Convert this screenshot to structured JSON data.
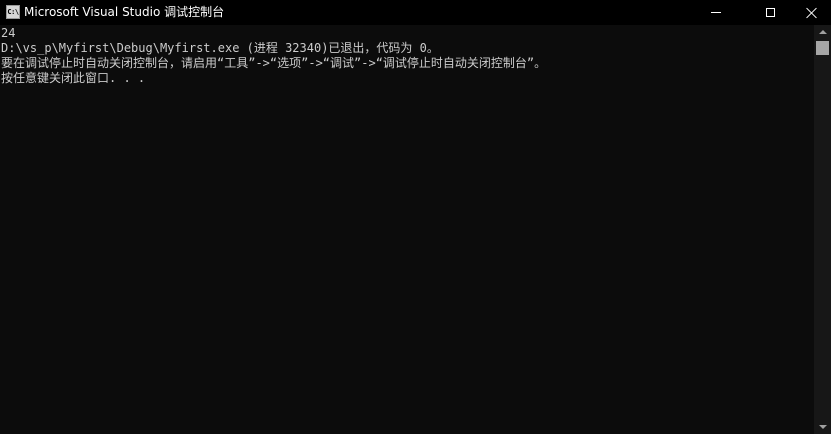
{
  "window": {
    "title": "Microsoft Visual Studio 调试控制台",
    "icon": "console-app-icon",
    "icon_text": "C:\\"
  },
  "console": {
    "lines": [
      "24",
      "D:\\vs_p\\Myfirst\\Debug\\Myfirst.exe (进程 32340)已退出，代码为 0。",
      "要在调试停止时自动关闭控制台，请启用“工具”->“选项”->“调试”->“调试停止时自动关闭控制台”。",
      "按任意键关闭此窗口. . ."
    ]
  },
  "colors": {
    "background": "#0c0c0c",
    "titlebar": "#000000",
    "text": "#cccccc",
    "scrollbar": "#171717",
    "thumb": "#a6a6a6"
  }
}
